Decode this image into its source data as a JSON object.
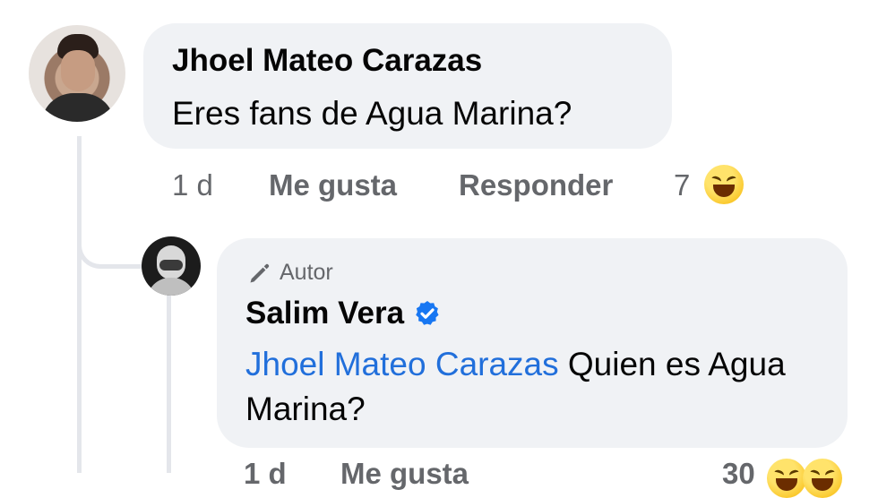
{
  "comment": {
    "author": "Jhoel Mateo Carazas",
    "text": "Eres fans de Agua Marina?",
    "time": "1 d",
    "like_label": "Me gusta",
    "reply_label": "Responder",
    "reaction_count": "7",
    "reaction_icon": "laughing-emoji-icon"
  },
  "reply": {
    "badge_label": "Autor",
    "author": "Salim Vera",
    "verified": true,
    "mention": "Jhoel Mateo Carazas",
    "text": " Quien es Agua Marina?",
    "time": "1 d",
    "like_label": "Me gusta",
    "reaction_count": "30"
  },
  "colors": {
    "bubble": "#f0f2f5",
    "meta": "#65676b",
    "mention": "#216fdb",
    "verified": "#1877f2"
  }
}
